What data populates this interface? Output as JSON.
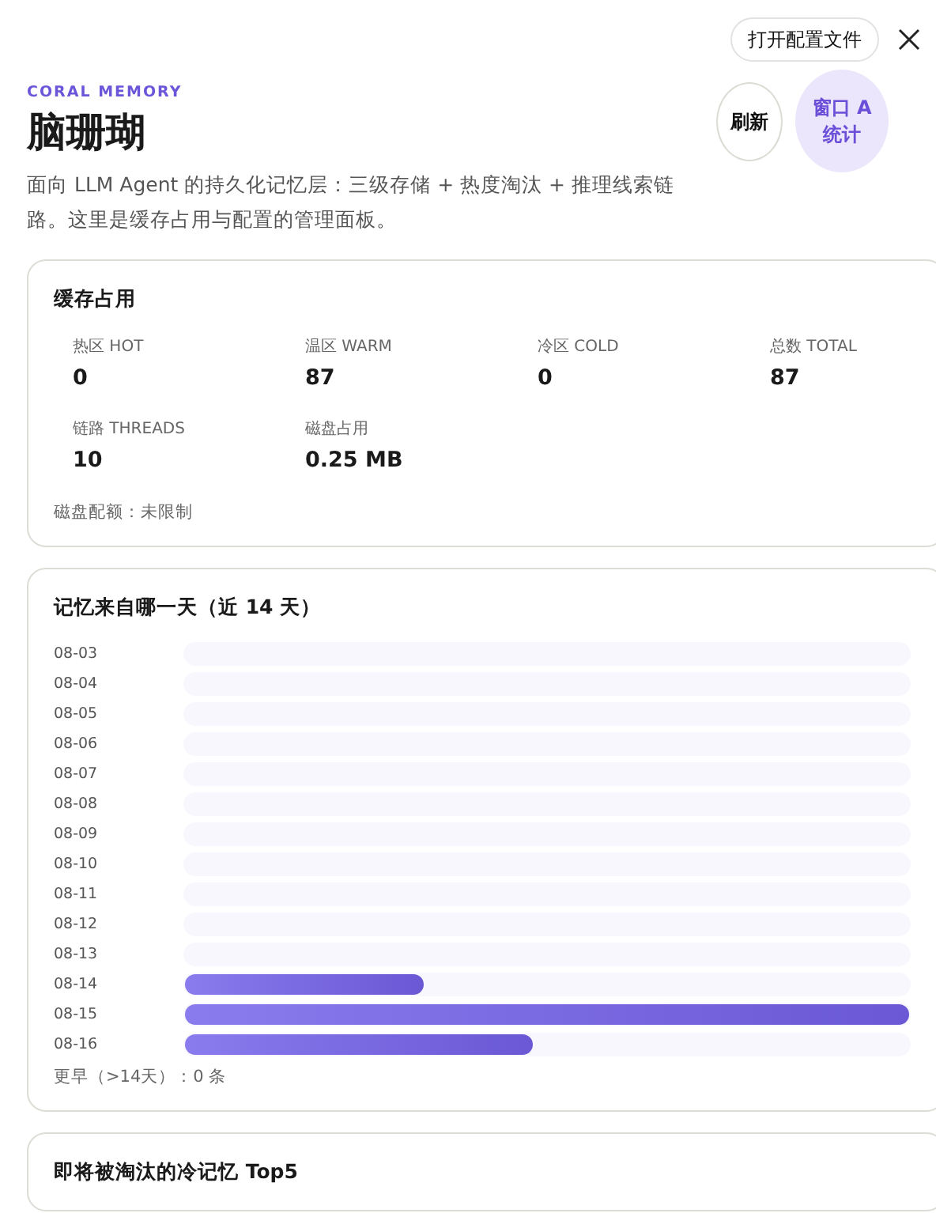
{
  "top_bar": {
    "open_config_button": "打开配置文件"
  },
  "header": {
    "eyebrow": "CORAL MEMORY",
    "title": "脑珊瑚",
    "description": "面向 LLM Agent 的持久化记忆层：三级存储 + 热度淘汰 + 推理线索链路。这里是缓存占用与配置的管理面板。",
    "buttons": [
      {
        "label": "刷新",
        "kind": "plain"
      },
      {
        "label": "窗口 A 统计",
        "kind": "accent"
      }
    ]
  },
  "cache_card": {
    "title": "缓存占用",
    "stats": [
      {
        "label": "热区 HOT",
        "value": "0"
      },
      {
        "label": "温区 WARM",
        "value": "87"
      },
      {
        "label": "冷区 COLD",
        "value": "0"
      },
      {
        "label": "总数 TOTAL",
        "value": "87"
      },
      {
        "label": "链路 THREADS",
        "value": "10"
      },
      {
        "label": "磁盘占用",
        "value": "0.25 MB"
      }
    ],
    "footer": "磁盘配额：未限制"
  },
  "days_card": {
    "title": "记忆来自哪一天（近 14 天）",
    "days": [
      {
        "date": "08-03",
        "level": 0
      },
      {
        "date": "08-04",
        "level": 0
      },
      {
        "date": "08-05",
        "level": 0
      },
      {
        "date": "08-06",
        "level": 0
      },
      {
        "date": "08-07",
        "level": 0
      },
      {
        "date": "08-08",
        "level": 0
      },
      {
        "date": "08-09",
        "level": 0
      },
      {
        "date": "08-10",
        "level": 0
      },
      {
        "date": "08-11",
        "level": 0
      },
      {
        "date": "08-12",
        "level": 0
      },
      {
        "date": "08-13",
        "level": 0
      },
      {
        "date": "08-14",
        "level": 0.33
      },
      {
        "date": "08-15",
        "level": 1
      },
      {
        "date": "08-16",
        "level": 0.48
      }
    ],
    "footer": "更早（>14天）：0 条"
  },
  "cold_card": {
    "title": "即将被淘汰的冷记忆 Top5"
  }
}
